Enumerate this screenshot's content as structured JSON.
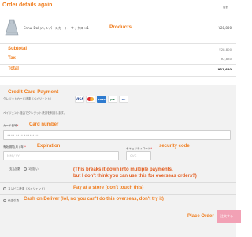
{
  "header": {
    "title": "Order details again",
    "total_col": "合計"
  },
  "product": {
    "name": "Ennui Dollジャンパースカート・サックス ×1",
    "price": "¥28,800",
    "annotation": "Products"
  },
  "summary": [
    {
      "label": "Subtotal",
      "value": "¥28,800"
    },
    {
      "label": "Tax",
      "value": "¥2,880"
    },
    {
      "label": "Total",
      "value": "¥31,680"
    }
  ],
  "payment": {
    "title": "Credit Card Payment",
    "subtitle": "クレジットカード決済（ペイジェント）",
    "cards": [
      "VISA",
      "MC",
      "AMEX",
      "JCB",
      "DC"
    ],
    "note": "ペイジェント経由でクレジット決済を利用します。",
    "card_number": {
      "label": "カード番号",
      "required": "*",
      "annotation": "Card number",
      "placeholder": "•••• •••• •••• ••••"
    },
    "expiry": {
      "label": "有効期限(月 / 年)",
      "required": "*",
      "annotation": "Expiration",
      "placeholder": "MM / YY"
    },
    "cvc": {
      "label": "セキュリティコード",
      "required": "*",
      "annotation": "security code",
      "placeholder": "CVC"
    },
    "installments": {
      "label": "支払回数",
      "option": "1回払い",
      "annotation_line1": "(This breaks it down into multiple payments,",
      "annotation_line2": "but I don't think you can use this for overseas orders?)"
    },
    "convenience": {
      "label": "コンビニ決済（ペイジェント）",
      "annotation": "Pay at a store (don't touch this)"
    },
    "cod": {
      "label": "代金引換",
      "annotation": "Cash on Deliver (lol, no you can't do this overseas, don't try it)"
    },
    "place_order": {
      "annotation": "Place Order",
      "button_label": "注文する"
    }
  }
}
